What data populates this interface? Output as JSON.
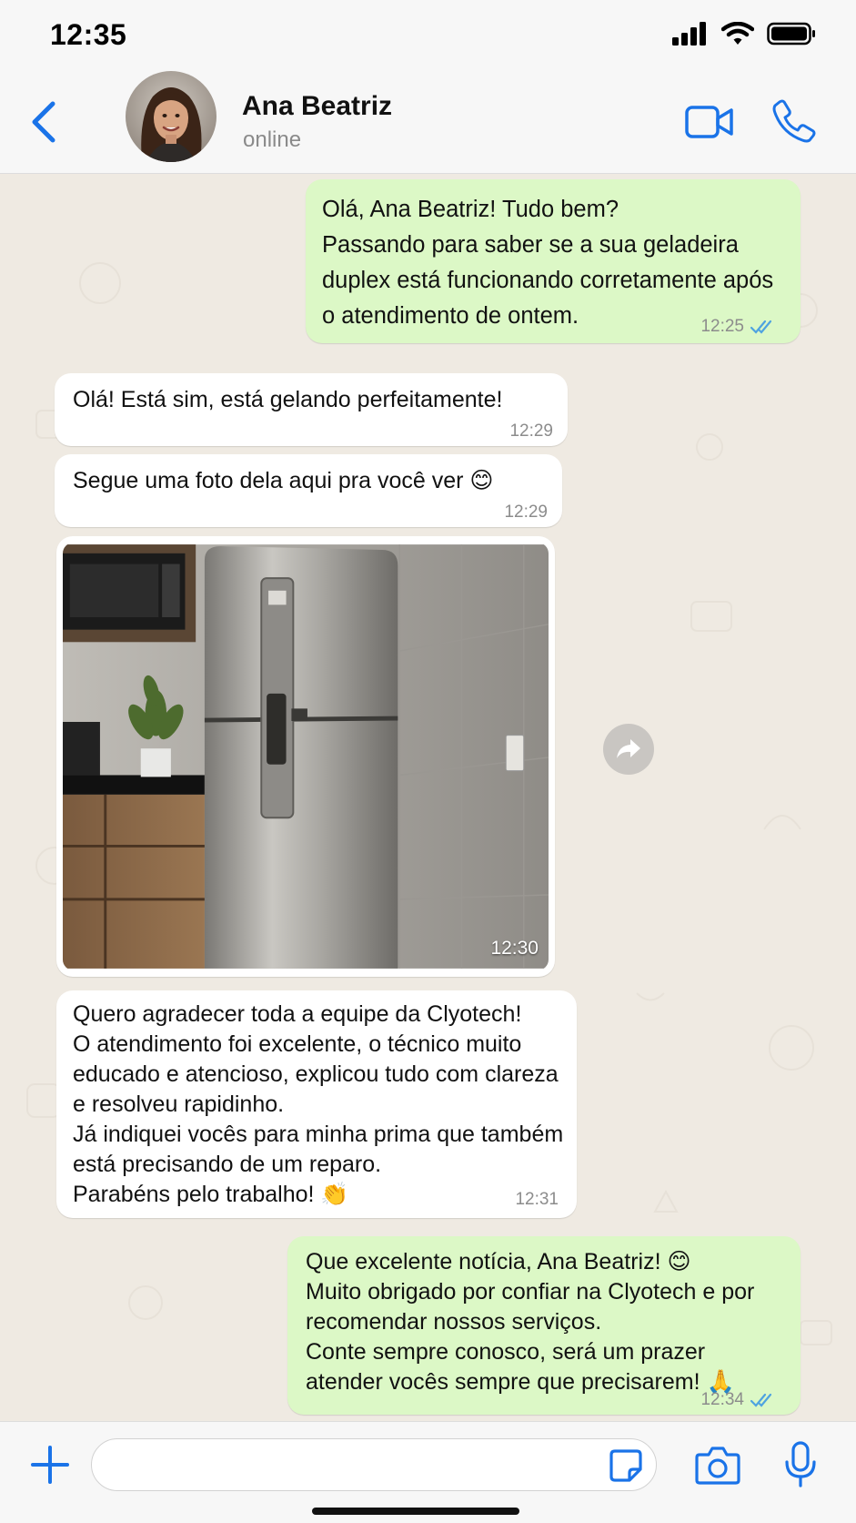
{
  "status_bar": {
    "time": "12:35"
  },
  "contact": {
    "name": "Ana Beatriz",
    "status": "online"
  },
  "colors": {
    "accent": "#1a73e8",
    "outgoing_bubble": "#dcf8c6",
    "incoming_bubble": "#ffffff",
    "read_ticks": "#4fa3e0"
  },
  "messages": [
    {
      "direction": "out",
      "text": "Olá, Ana Beatriz! Tudo bem?\nPassando para saber se a sua geladeira duplex está funcionando corretamente após o atendimento de ontem.",
      "time": "12:25",
      "status": "read"
    },
    {
      "direction": "in",
      "text": "Olá! Está sim, está gelando perfeitamente!",
      "time": "12:29"
    },
    {
      "direction": "in",
      "text": "Segue uma foto dela aqui pra você ver 😊",
      "time": "12:29"
    },
    {
      "direction": "in",
      "type": "photo",
      "photo_subject": "stainless steel duplex refrigerator in a kitchen",
      "time": "12:30"
    },
    {
      "direction": "in",
      "text": "Quero agradecer toda a equipe da Clyotech!\nO atendimento foi excelente, o técnico muito educado e atencioso, explicou tudo com clareza e resolveu rapidinho.\nJá indiquei vocês para minha prima que também está precisando de um reparo.\nParabéns pelo trabalho! 👏",
      "time": "12:31"
    },
    {
      "direction": "out",
      "text": "Que excelente notícia, Ana Beatriz! 😊\nMuito obrigado por confiar na Clyotech e por recomendar nossos serviços.\nConte sempre conosco, será um prazer atender vocês sempre que precisarem! 🙏",
      "time": "12:34",
      "status": "read"
    }
  ],
  "input": {
    "value": "",
    "placeholder": ""
  },
  "icons": {
    "back": "chevron-left-icon",
    "video": "video-camera-icon",
    "call": "phone-icon",
    "forward": "forward-arrow-icon",
    "add": "plus-icon",
    "sticker": "sticker-icon",
    "camera": "camera-icon",
    "mic": "microphone-icon"
  }
}
